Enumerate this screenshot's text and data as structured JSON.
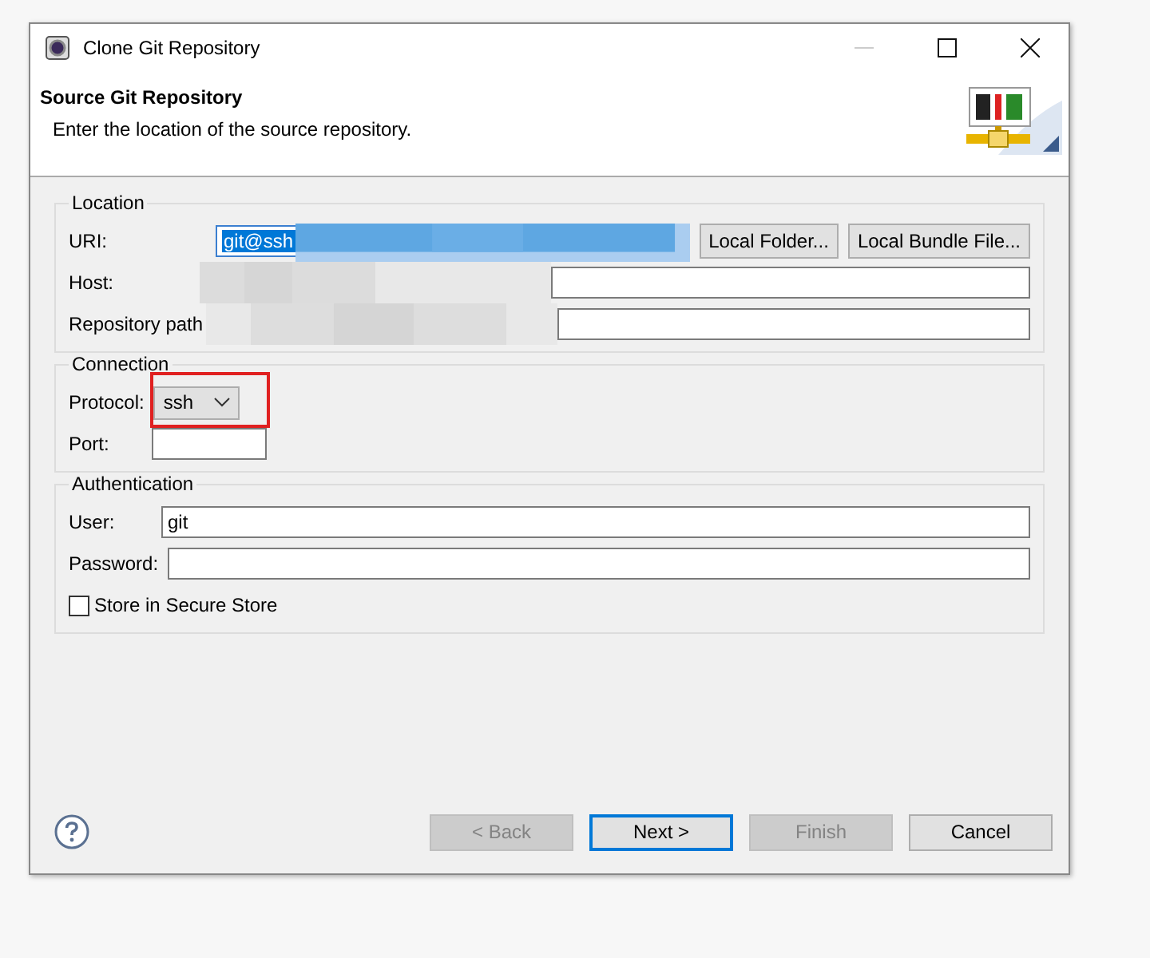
{
  "window": {
    "title": "Clone Git Repository"
  },
  "header": {
    "title": "Source Git Repository",
    "description": "Enter the location of the source repository."
  },
  "location": {
    "title": "Location",
    "uri": {
      "label": "URI:",
      "value": "git@ssh",
      "selected": true
    },
    "buttons": [
      {
        "label": "Local Folder..."
      },
      {
        "label": "Local Bundle File..."
      }
    ],
    "host": {
      "label": "Host:"
    },
    "repository_path": {
      "label": "Repository path"
    }
  },
  "connection": {
    "title": "Connection",
    "protocol": {
      "label": "Protocol:",
      "value": "ssh"
    },
    "port": {
      "label": "Port:"
    }
  },
  "authentication": {
    "title": "Authentication",
    "user": {
      "label": "User:",
      "value": "git"
    },
    "password": {
      "label": "Password:"
    },
    "store": {
      "label": "Store in Secure Store",
      "checked": false
    }
  },
  "buttons": [
    {
      "label": "< Back",
      "disabled": true,
      "default": false
    },
    {
      "label": "Next >",
      "disabled": false,
      "default": true
    },
    {
      "label": "Finish",
      "disabled": true,
      "default": false
    },
    {
      "label": "Cancel",
      "disabled": false,
      "default": false
    }
  ]
}
